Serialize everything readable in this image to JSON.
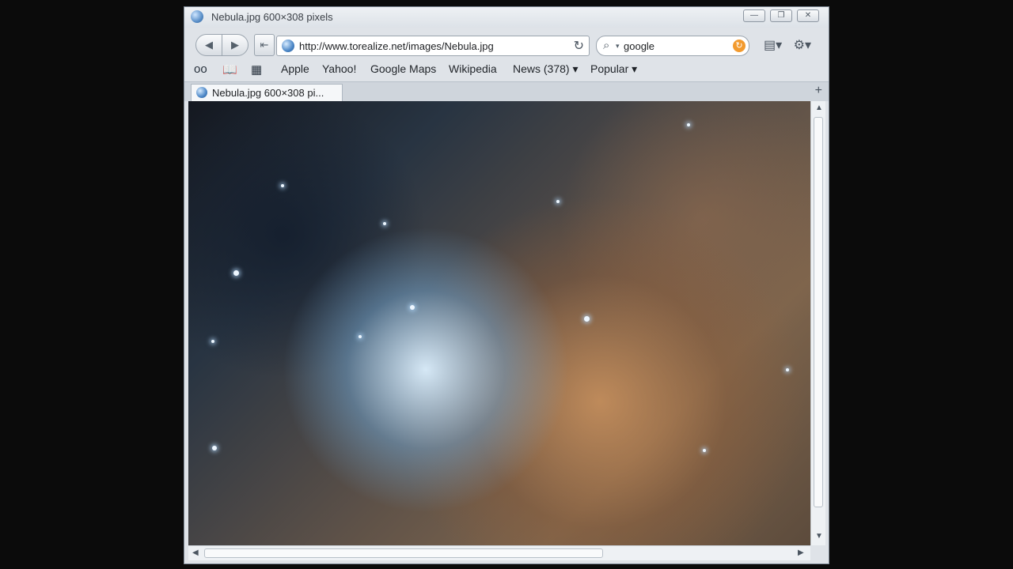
{
  "window": {
    "title": "Nebula.jpg 600×308 pixels",
    "controls": {
      "minimize": "—",
      "restore": "❐",
      "close": "✕"
    }
  },
  "toolbar": {
    "back": "◀",
    "forward": "▶",
    "home": "⇤",
    "address": "http://www.torealize.net/images/Nebula.jpg",
    "reload": "↻",
    "search_value": "google",
    "search_go": "↻"
  },
  "bookmarks": {
    "items": [
      "Apple",
      "Yahoo!",
      "Google Maps",
      "Wikipedia",
      "News (378) ▾",
      "Popular ▾"
    ]
  },
  "tabs": [
    {
      "label": "Nebula.jpg 600×308 pi..."
    }
  ],
  "tabbar": {
    "new_tab": "+"
  },
  "scroll": {
    "vertical_fraction": 0.95,
    "horizontal_fraction": 0.62
  },
  "icons": {
    "window_icon": "globe-icon",
    "site_icon": "globe-icon",
    "reader_icon": "glasses-icon",
    "bookmarks_icon": "book-icon",
    "topsites_icon": "grid-icon",
    "page_menu_icon": "page-icon",
    "settings_icon": "gear-icon"
  }
}
